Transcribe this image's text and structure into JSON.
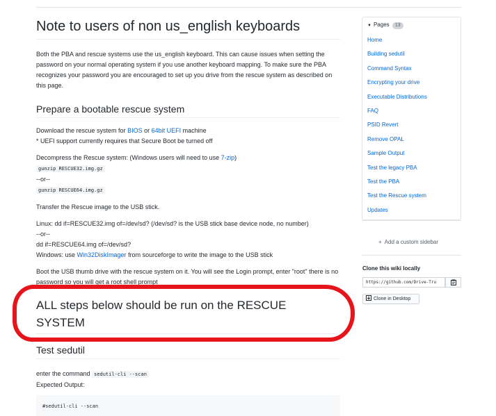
{
  "main": {
    "title": "Note to users of non us_english keyboards",
    "intro": "Both the PBA and rescue systems use the us_english keyboard. This can cause issues when setting the password on your normal operating system if you use another keyboard mapping. To make sure the PBA recognizes your password you are encouraged to set up you drive from the rescue system as described on this page.",
    "prepare_heading": "Prepare a bootable rescue system",
    "download": {
      "prefix": "Download the rescue system for ",
      "bios_link": "BIOS",
      "or": " or ",
      "uefi_link": "64bit UEFI",
      "suffix": " machine",
      "note": "* UEFI support currently requires that Secure Boot be turned off"
    },
    "decompress": {
      "prefix": "Decompress the Rescue system: (Windows users will need to use ",
      "zip_link": "7-zip",
      "suffix": ")",
      "cmd1": "gunzip RESCUE32.img.gz",
      "or": "--or--",
      "cmd2": "gunzip RESCUE64.img.gz"
    },
    "transfer": "Transfer the Rescue image to the USB stick.",
    "linux": {
      "line1": "Linux: dd if=RESCUE32.img of=/dev/sd? (/dev/sd? is the USB stick base device node, no number)",
      "or": "--or--",
      "line2": "dd if=RESCUE64.img of=/dev/sd?",
      "win_prefix": "Windows: use ",
      "win_link": "Win32DiskImager",
      "win_suffix": " from sourceforge to write the image to the USB stick"
    },
    "boot": "Boot the USB thumb drive with the rescue system on it. You will see the Login prompt, enter \"root\" there is no password so you will get a root shell prompt",
    "rescue_heading": "ALL steps below should be run on the RESCUE SYSTEM",
    "test_heading": "Test sedutil",
    "test": {
      "prefix": "enter the command ",
      "cmd": "sedutil-cli --scan",
      "expected": "Expected Output:",
      "code": "#sedutil-cli --scan"
    }
  },
  "sidebar": {
    "pages_label": "Pages",
    "pages_count": "13",
    "pages": [
      "Home",
      "Building sedutil",
      "Command Syntax",
      "Encrypting your drive",
      "Executable Distributions",
      "FAQ",
      "PSID Revert",
      "Remove OPAL",
      "Sample Output",
      "Test the legacy PBA",
      "Test the PBA",
      "Test the Rescue system",
      "Updates"
    ],
    "add_sidebar": "Add a custom sidebar",
    "clone_title": "Clone this wiki locally",
    "clone_url": "https://github.com/Drive-Tru",
    "clone_desktop": "Clone in Desktop"
  },
  "colors": {
    "link": "#0366d6",
    "annotation": "#e8141c"
  }
}
